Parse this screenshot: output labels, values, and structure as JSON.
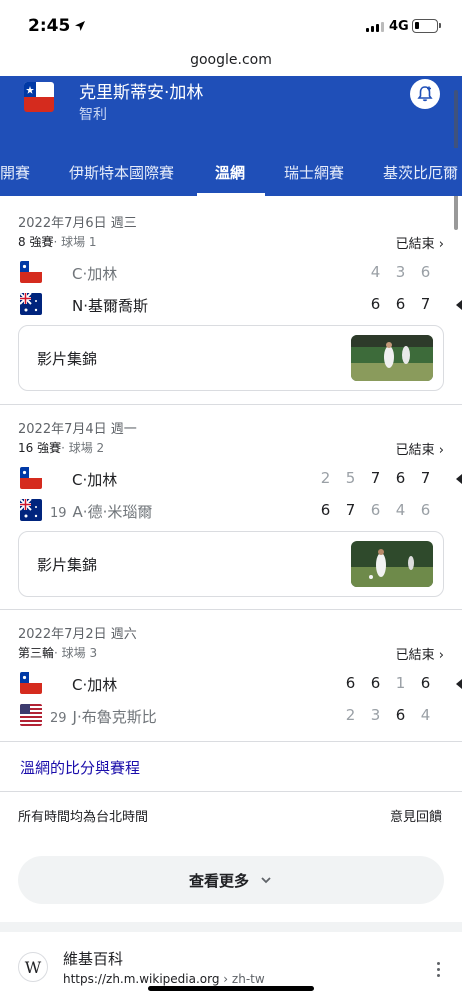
{
  "status_bar": {
    "time": "2:45",
    "network": "4G"
  },
  "url_bar": {
    "domain": "google.com"
  },
  "header": {
    "player_name": "克里斯蒂安·加林",
    "country": "智利"
  },
  "tabs": [
    {
      "label": "開賽"
    },
    {
      "label": "伊斯特本國際賽"
    },
    {
      "label": "溫網",
      "active": true
    },
    {
      "label": "瑞士網賽"
    },
    {
      "label": "基茨比厄爾"
    }
  ],
  "matches": [
    {
      "date": "2022年7月6日 週三",
      "round": "8 強賽",
      "court": "· 球場 1",
      "status": "已結束",
      "players": [
        {
          "name": "C·加林",
          "seed": "",
          "flag": "chile",
          "scores": [
            "4",
            "3",
            "6"
          ],
          "winner": false
        },
        {
          "name": "N·基爾喬斯",
          "seed": "",
          "flag": "australia",
          "scores": [
            "6",
            "6",
            "7"
          ],
          "winner": true
        }
      ],
      "video_label": "影片集錦"
    },
    {
      "date": "2022年7月4日 週一",
      "round": "16 強賽",
      "court": "· 球場 2",
      "status": "已結束",
      "players": [
        {
          "name": "C·加林",
          "seed": "",
          "flag": "chile",
          "scores": [
            "2",
            "5",
            "7",
            "6",
            "7"
          ],
          "winner": true
        },
        {
          "name": "A·德·米瑙爾",
          "seed": "19",
          "flag": "australia",
          "scores": [
            "6",
            "7",
            "6",
            "4",
            "6"
          ],
          "winner": false
        }
      ],
      "video_label": "影片集錦"
    },
    {
      "date": "2022年7月2日 週六",
      "round": "第三輪",
      "court": "· 球場 3",
      "status": "已結束",
      "players": [
        {
          "name": "C·加林",
          "seed": "",
          "flag": "chile",
          "scores": [
            "6",
            "6",
            "1",
            "6"
          ],
          "winner": true
        },
        {
          "name": "J·布魯克斯比",
          "seed": "29",
          "flag": "usa",
          "scores": [
            "2",
            "3",
            "6",
            "4"
          ],
          "winner": false
        }
      ]
    }
  ],
  "footer": {
    "link": "溫網的比分與賽程",
    "timezone": "所有時間均為台北時間",
    "feedback": "意見回饋",
    "more_button": "查看更多"
  },
  "wiki_result": {
    "icon_letter": "W",
    "title": "維基百科",
    "url": "https://zh.m.wikipedia.org",
    "breadcrumb": "› zh-tw"
  },
  "colors": {
    "header_blue": "#1f4fb8",
    "link_blue": "#1a0dab",
    "chile_red": "#d52b1e",
    "chile_blue": "#0039a6",
    "australia_blue": "#00247d"
  }
}
